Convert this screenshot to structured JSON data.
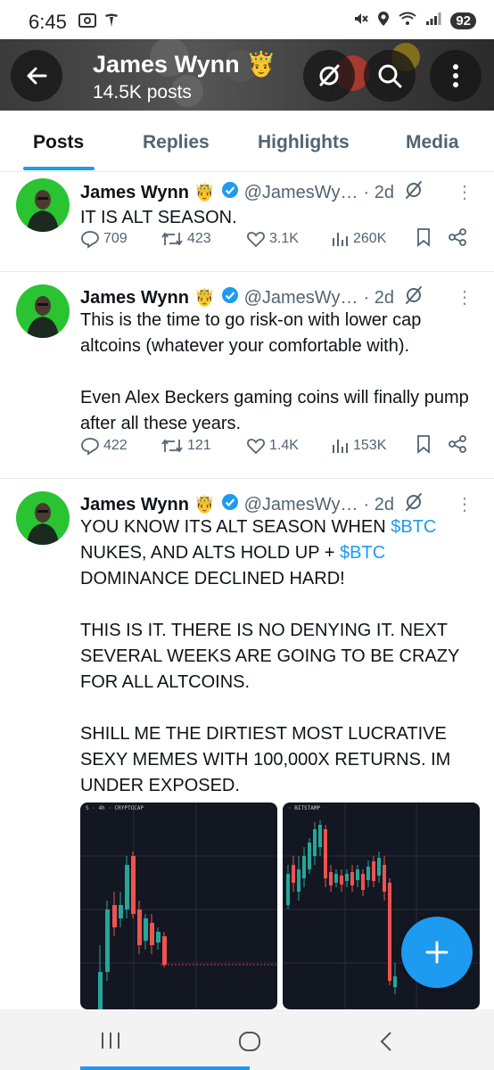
{
  "status_bar": {
    "time": "6:45",
    "battery": "92",
    "icons": [
      "screenshot-icon",
      "tesla-icon",
      "mute-icon",
      "location-icon",
      "wifi-icon",
      "signal-icon"
    ]
  },
  "header": {
    "name": "James Wynn",
    "crown": "🤴",
    "post_count": "14.5K posts"
  },
  "tabs": [
    {
      "label": "Posts",
      "active": true
    },
    {
      "label": "Replies",
      "active": false
    },
    {
      "label": "Highlights",
      "active": false
    },
    {
      "label": "Media",
      "active": false
    }
  ],
  "posts": [
    {
      "name": "James Wynn",
      "crown": "🤴",
      "handle": "@JamesWy…",
      "time": "· 2d",
      "paragraphs": [
        "IT IS ALT SEASON."
      ],
      "replies": "709",
      "reposts": "423",
      "likes": "3.1K",
      "views": "260K"
    },
    {
      "name": "James Wynn",
      "crown": "🤴",
      "handle": "@JamesWy…",
      "time": "· 2d",
      "paragraphs": [
        "This is the time to go risk-on with lower cap altcoins (whatever your comfortable with).",
        "Even Alex Beckers gaming coins will finally pump after all these years."
      ],
      "replies": "422",
      "reposts": "121",
      "likes": "1.4K",
      "views": "153K"
    },
    {
      "name": "James Wynn",
      "crown": "🤴",
      "handle": "@JamesWy…",
      "time": "· 2d",
      "p1_a": "YOU KNOW ITS ALT SEASON WHEN ",
      "p1_cash1": "$BTC",
      "p1_b": " NUKES, AND ALTS HOLD UP + ",
      "p1_cash2": "$BTC",
      "p1_c": " DOMINANCE DECLINED HARD!",
      "p2": "THIS IS IT. THERE IS NO DENYING IT. NEXT SEVERAL WEEKS ARE GOING TO BE CRAZY FOR ALL ALTCOINS.",
      "p3": "SHILL ME THE DIRTIEST MOST LUCRATIVE SEXY MEMES WITH 100,000X RETURNS. IM UNDER EXPOSED.",
      "media_labels": [
        "S · 4h · CRYPTOCAP",
        "· BITSTAMP"
      ]
    }
  ],
  "colors": {
    "accent": "#1d9bf0",
    "up": "#26a69a",
    "down": "#ef5350",
    "avatar_bg": "#2ac432"
  }
}
